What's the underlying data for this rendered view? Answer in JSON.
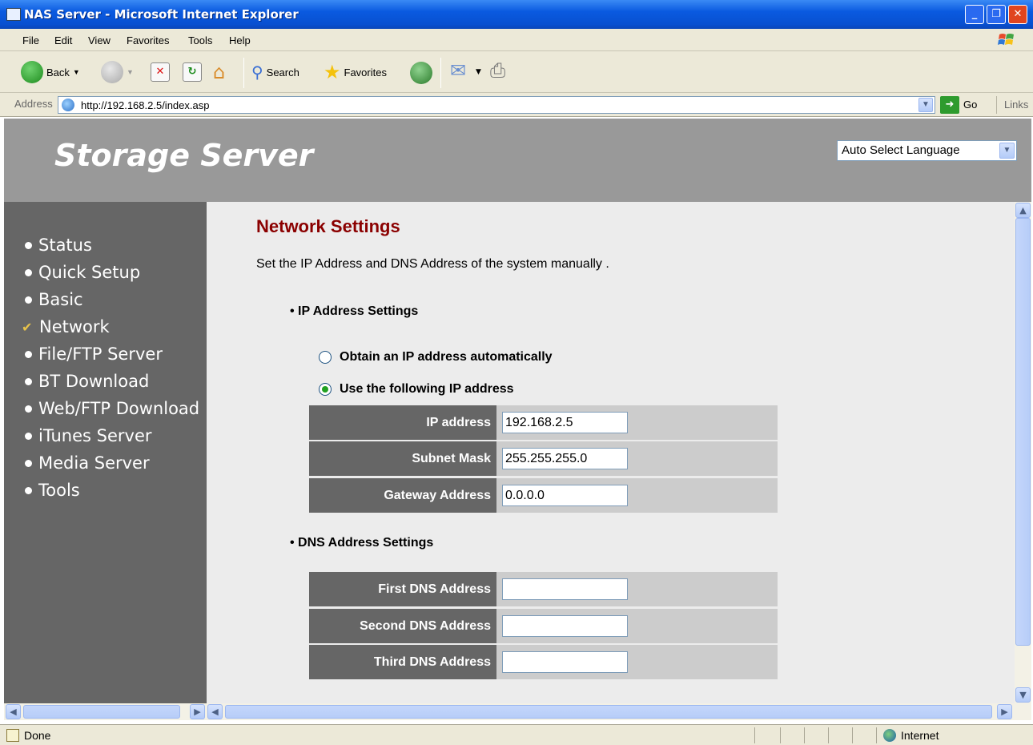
{
  "window": {
    "title": "NAS Server - Microsoft Internet Explorer",
    "controls": {
      "minimize": "_",
      "maximize": "❐",
      "close": "✕"
    }
  },
  "menubar": {
    "items": [
      "File",
      "Edit",
      "View",
      "Favorites",
      "Tools",
      "Help"
    ]
  },
  "toolbar": {
    "back_label": "Back",
    "search_label": "Search",
    "favorites_label": "Favorites"
  },
  "addressbar": {
    "label": "Address",
    "url": "http://192.168.2.5/index.asp",
    "go_label": "Go",
    "links_label": "Links"
  },
  "header": {
    "brand": "Storage Server",
    "language_select": "Auto Select Language"
  },
  "sidebar": {
    "items": [
      {
        "label": "Status",
        "active": false
      },
      {
        "label": "Quick Setup",
        "active": false
      },
      {
        "label": "Basic",
        "active": false
      },
      {
        "label": "Network",
        "active": true
      },
      {
        "label": "File/FTP Server",
        "active": false
      },
      {
        "label": "BT Download",
        "active": false
      },
      {
        "label": "Web/FTP Download",
        "active": false
      },
      {
        "label": "iTunes Server",
        "active": false
      },
      {
        "label": "Media Server",
        "active": false
      },
      {
        "label": "Tools",
        "active": false
      }
    ]
  },
  "main": {
    "title": "Network Settings",
    "description": "Set the IP Address and DNS Address of the system manually .",
    "ip_section": {
      "heading": "IP Address Settings",
      "radio_auto": "Obtain an IP address automatically",
      "radio_manual": "Use the following IP address",
      "selected": "manual",
      "fields": [
        {
          "label": "IP address",
          "value": "192.168.2.5"
        },
        {
          "label": "Subnet Mask",
          "value": "255.255.255.0"
        },
        {
          "label": "Gateway Address",
          "value": "0.0.0.0"
        }
      ]
    },
    "dns_section": {
      "heading": "DNS Address Settings",
      "fields": [
        {
          "label": "First DNS Address",
          "value": ""
        },
        {
          "label": "Second DNS Address",
          "value": ""
        },
        {
          "label": "Third DNS Address",
          "value": ""
        }
      ]
    }
  },
  "statusbar": {
    "left": "Done",
    "zone": "Internet"
  },
  "colors": {
    "page_title": "#8b0000",
    "sidebar_bg": "#666666",
    "header_bg": "#999999",
    "content_bg": "#ececec",
    "row_value_bg": "#cccccc",
    "titlebar_blue": "#0a5ae0"
  }
}
